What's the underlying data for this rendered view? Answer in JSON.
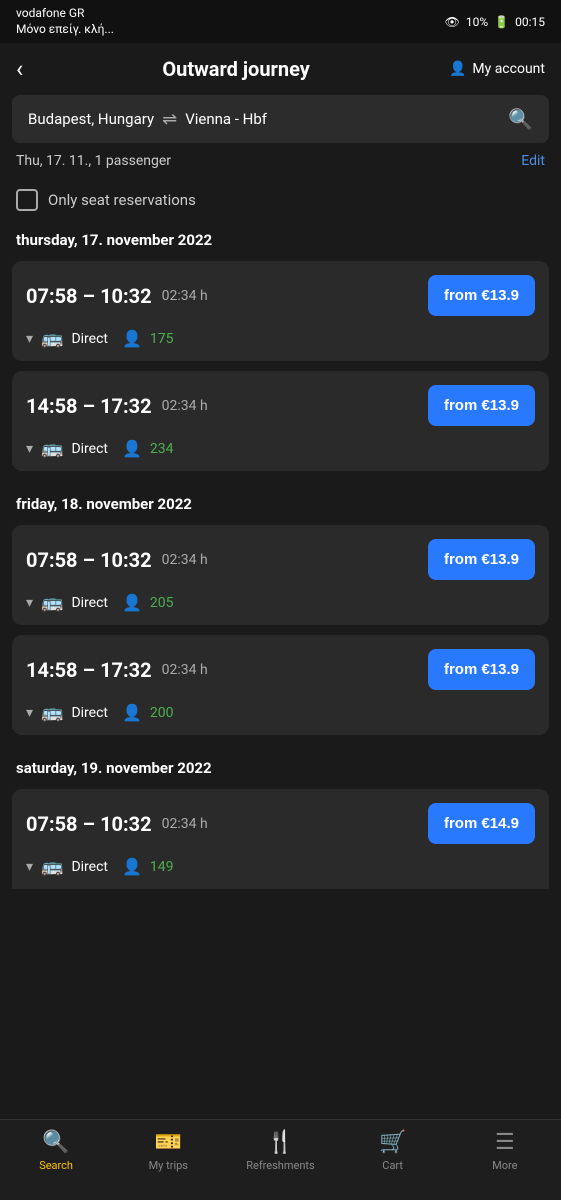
{
  "statusBar": {
    "carrier": "vodafone GR",
    "signal_text": "Μόνο επείγ. κλή...",
    "battery": "10%",
    "time": "00:15"
  },
  "header": {
    "back_label": "‹",
    "title": "Outward journey",
    "account_label": "My account"
  },
  "searchBar": {
    "origin": "Budapest, Hungary",
    "destination": "Vienna - Hbf",
    "arrow": "⇌"
  },
  "tripInfo": {
    "date": "Thu, 17. 11., 1 passenger",
    "edit_label": "Edit"
  },
  "filter": {
    "label": "Only seat reservations"
  },
  "sections": [
    {
      "heading": "thursday, 17. november 2022",
      "trips": [
        {
          "time_range": "07:58 – 10:32",
          "duration": "02:34 h",
          "price": "from €13.9",
          "type": "Direct",
          "seats": "175"
        },
        {
          "time_range": "14:58 – 17:32",
          "duration": "02:34 h",
          "price": "from €13.9",
          "type": "Direct",
          "seats": "234"
        }
      ]
    },
    {
      "heading": "friday, 18. november 2022",
      "trips": [
        {
          "time_range": "07:58 – 10:32",
          "duration": "02:34 h",
          "price": "from €13.9",
          "type": "Direct",
          "seats": "205"
        },
        {
          "time_range": "14:58 – 17:32",
          "duration": "02:34 h",
          "price": "from €13.9",
          "type": "Direct",
          "seats": "200"
        }
      ]
    },
    {
      "heading": "saturday, 19. november 2022",
      "trips": [
        {
          "time_range": "07:58 – 10:32",
          "duration": "02:34 h",
          "price": "from €14.9",
          "type": "Direct",
          "seats": "149"
        }
      ]
    }
  ],
  "bottomNav": {
    "items": [
      {
        "icon": "🔍",
        "label": "Search",
        "active": true
      },
      {
        "icon": "🎫",
        "label": "My trips",
        "active": false
      },
      {
        "icon": "🍴",
        "label": "Refreshments",
        "active": false
      },
      {
        "icon": "🛒",
        "label": "Cart",
        "active": false
      },
      {
        "icon": "☰",
        "label": "More",
        "active": false
      }
    ]
  },
  "gestureBar": {
    "back": "◁",
    "home": "○",
    "recent": "□"
  }
}
